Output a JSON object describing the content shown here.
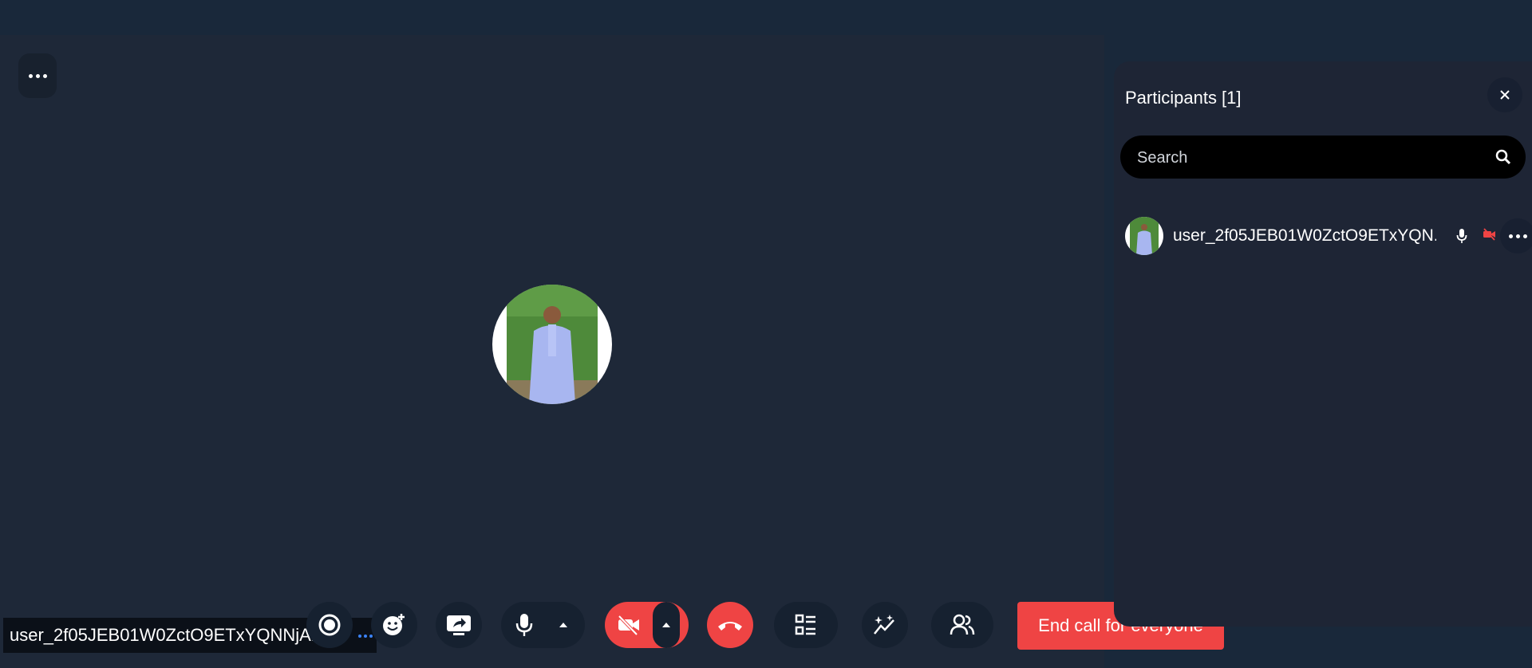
{
  "stage": {
    "self_name": "user_2f05JEB01W0ZctO9ETxYQNNjAk"
  },
  "controls": {
    "end_call_everyone_label": "End call for everyone"
  },
  "participants_panel": {
    "title": "Participants [1]",
    "search_placeholder": "Search",
    "participants": [
      {
        "name": "user_2f05JEB01W0ZctO9ETxYQN..."
      }
    ]
  },
  "colors": {
    "accent_red": "#ef4444",
    "panel_bg": "#1e2535",
    "stage_bg": "#1e2838",
    "dot_blue": "#3b82f6"
  }
}
